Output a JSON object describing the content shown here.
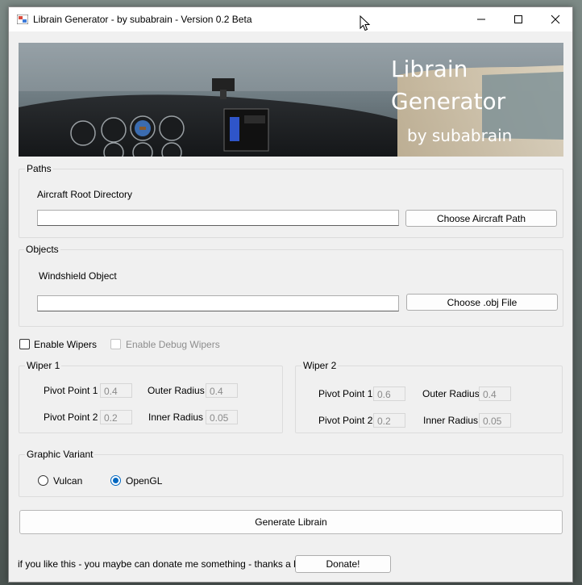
{
  "window": {
    "title": "Librain Generator - by subabrain - Version 0.2 Beta"
  },
  "banner": {
    "line1": "Librain",
    "line2": "Generator",
    "line3": "by subabrain"
  },
  "paths": {
    "legend": "Paths",
    "aircraft_root_label": "Aircraft Root Directory",
    "aircraft_root_value": "",
    "choose_button": "Choose Aircraft Path"
  },
  "objects": {
    "legend": "Objects",
    "windshield_label": "Windshield Object",
    "windshield_value": "",
    "choose_button": "Choose .obj File"
  },
  "options": {
    "enable_wipers": "Enable Wipers",
    "enable_debug_wipers": "Enable Debug Wipers"
  },
  "wiper1": {
    "legend": "Wiper 1",
    "pivot1_label": "Pivot Point 1",
    "pivot1_value": "0.4",
    "pivot2_label": "Pivot Point 2",
    "pivot2_value": "0.2",
    "outer_label": "Outer Radius",
    "outer_value": "0.4",
    "inner_label": "Inner Radius",
    "inner_value": "0.05"
  },
  "wiper2": {
    "legend": "Wiper 2",
    "pivot1_label": "Pivot Point 1",
    "pivot1_value": "0.6",
    "pivot2_label": "Pivot Point 2",
    "pivot2_value": "0.2",
    "outer_label": "Outer Radius",
    "outer_value": "0.4",
    "inner_label": "Inner Radius",
    "inner_value": "0.05"
  },
  "graphic": {
    "legend": "Graphic Variant",
    "vulkan": "Vulcan",
    "opengl": "OpenGL",
    "selected": "OpenGL"
  },
  "generate_button": "Generate Librain",
  "footer": {
    "message": "if you like this - you maybe can donate me something - thanks a lot!",
    "donate_button": "Donate!"
  },
  "colors": {
    "accent": "#0067c0",
    "window_bg": "#f0f0f0"
  }
}
